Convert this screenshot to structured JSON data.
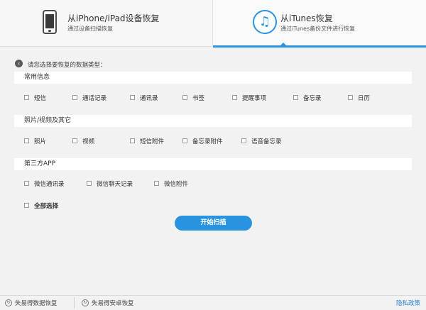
{
  "tabs": [
    {
      "title": "从iPhone/iPad设备恢复",
      "subtitle": "通过设备扫描恢复",
      "icon": "phone-icon"
    },
    {
      "title": "从iTunes恢复",
      "subtitle": "通过iTunes备份文件进行恢复",
      "icon": "music-note-icon",
      "active": true
    }
  ],
  "prompt": "请您选择要恢复的数据类型：",
  "sections": [
    {
      "title": "常用信息",
      "options": [
        "短信",
        "通话记录",
        "通讯录",
        "书签",
        "提醒事项",
        "备忘录",
        "日历"
      ]
    },
    {
      "title": "照片/视频及其它",
      "options": [
        "照片",
        "视频",
        "短信附件",
        "备忘录附件",
        "语音备忘录"
      ]
    },
    {
      "title": "第三方APP",
      "options": [
        "微信通讯录",
        "微信聊天记录",
        "微信附件"
      ]
    }
  ],
  "select_all": "全部选择",
  "scan_button": "开始扫描",
  "footer": {
    "items": [
      "失易得数据恢复",
      "失易得安卓恢复"
    ],
    "privacy": "隐私政策"
  },
  "colors": {
    "accent": "#2a93e0",
    "link": "#2a7fd0"
  }
}
